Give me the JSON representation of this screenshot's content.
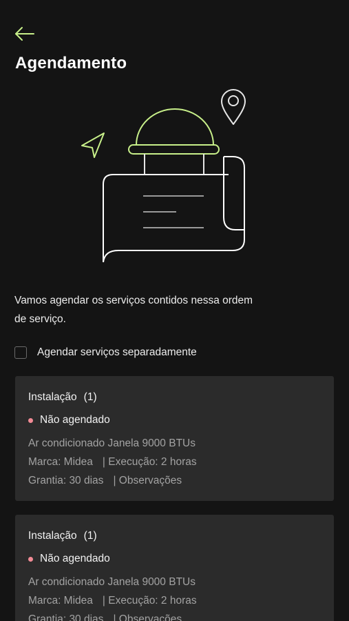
{
  "header": {
    "back_icon": "arrow-left-icon",
    "title": "Agendamento"
  },
  "illustration": {
    "icons": [
      "location-pin-icon",
      "navigation-arrow-icon",
      "service-order-scroll-icon"
    ],
    "colors": {
      "accent": "#c8f08a",
      "line": "#ffffff"
    }
  },
  "intro": {
    "text": "Vamos agendar os serviços contidos nessa ordem de serviço."
  },
  "separate_option": {
    "label": "Agendar serviços separadamente",
    "checked": false
  },
  "services": [
    {
      "title": "Instalação",
      "count": "(1)",
      "status": "Não agendado",
      "status_color": "#f28b95",
      "product": "Ar condicionado Janela 9000 BTUs",
      "brand": "Marca: Midea",
      "execution": "| Execução: 2 horas",
      "warranty": "Grantia: 30 dias",
      "observations": "| Observações"
    },
    {
      "title": "Instalação",
      "count": "(1)",
      "status": "Não agendado",
      "status_color": "#f28b95",
      "product": "Ar condicionado Janela 9000 BTUs",
      "brand": "Marca: Midea",
      "execution": "| Execução: 2 horas",
      "warranty": "Grantia: 30 dias",
      "observations": "| Observações"
    }
  ]
}
